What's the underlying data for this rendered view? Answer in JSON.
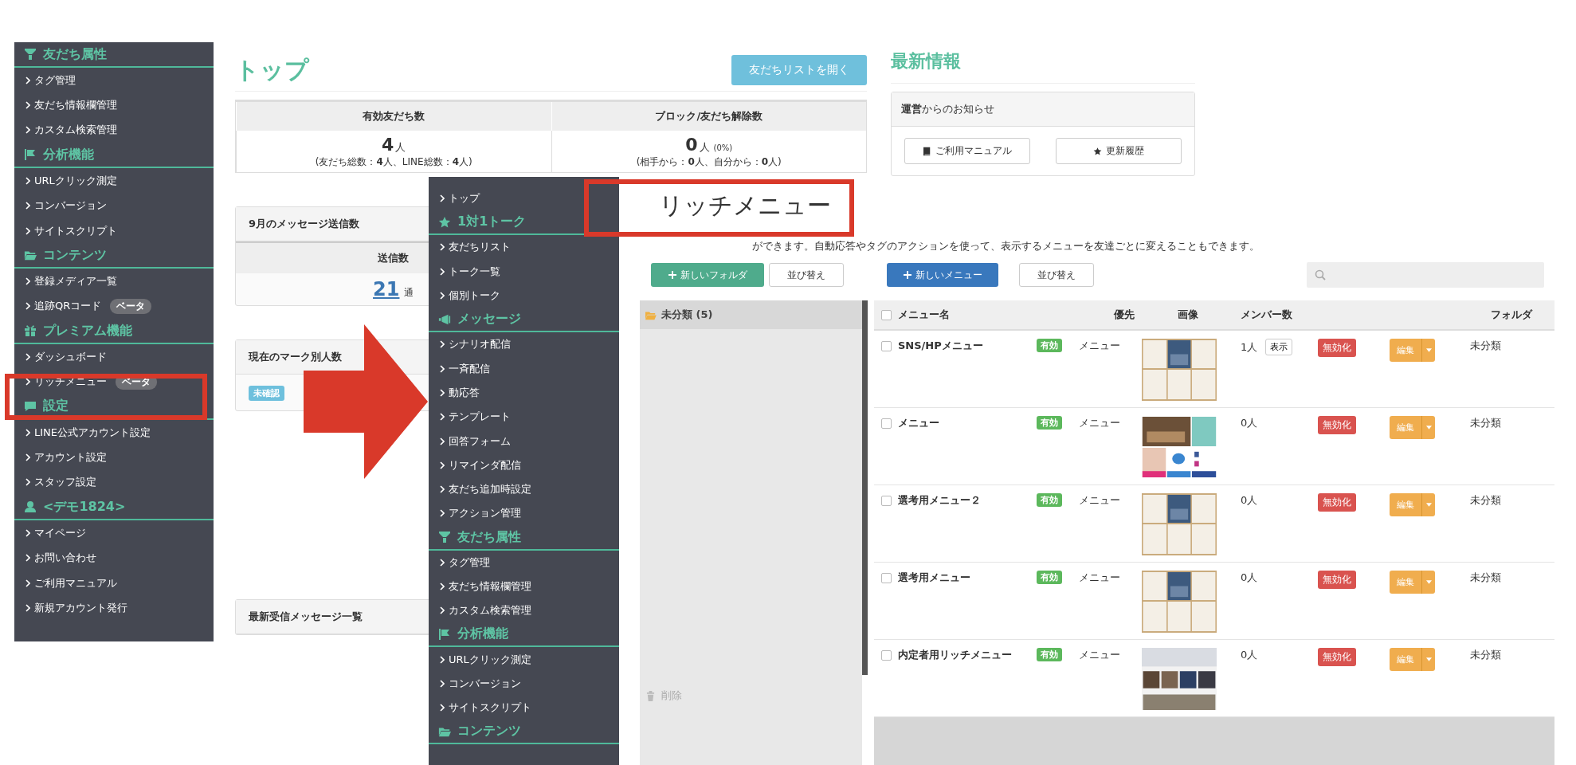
{
  "back_screen": {
    "sidebar": {
      "sections": [
        {
          "title": "友だち属性",
          "items": [
            {
              "label": "タグ管理"
            },
            {
              "label": "友だち情報欄管理"
            },
            {
              "label": "カスタム検索管理"
            }
          ]
        },
        {
          "title": "分析機能",
          "items": [
            {
              "label": "URLクリック測定"
            },
            {
              "label": "コンバージョン"
            },
            {
              "label": "サイトスクリプト"
            }
          ]
        },
        {
          "title": "コンテンツ",
          "items": [
            {
              "label": "登録メディア一覧"
            },
            {
              "label": "追跡QRコード",
              "badge": "ベータ"
            }
          ]
        },
        {
          "title": "プレミアム機能",
          "items": [
            {
              "label": "ダッシュボード"
            },
            {
              "label": "リッチメニュー",
              "badge": "ベータ"
            }
          ]
        },
        {
          "title": "設定",
          "items": [
            {
              "label": "LINE公式アカウント設定"
            },
            {
              "label": "アカウント設定"
            },
            {
              "label": "スタッフ設定"
            }
          ]
        },
        {
          "title": "<デモ1824>",
          "items": [
            {
              "label": "マイページ"
            },
            {
              "label": "お問い合わせ"
            },
            {
              "label": "ご利用マニュアル"
            },
            {
              "label": "新規アカウント発行"
            }
          ]
        }
      ]
    },
    "page": {
      "title": "トップ",
      "open_list_button": "友だちリストを開く",
      "friend_stats": [
        {
          "heading": "有効友だち数",
          "value": "4",
          "unit": "人",
          "detail": "(友だち総数：**4**人、LINE総数：**4**人)"
        },
        {
          "heading": "ブロック/友だち解除数",
          "value": "0",
          "unit": "人",
          "percent": "(0%)",
          "detail": "(相手から：**0**人、自分から：**0**人)"
        }
      ],
      "message_card": {
        "title": "9月のメッセージ送信数",
        "column": "送信数",
        "value": "21",
        "unit": "通"
      },
      "mark_card": {
        "title": "現在のマーク別人数",
        "tags": [
          "未確認"
        ]
      },
      "inbox_card": {
        "title": "最新受信メッセージ一覧"
      }
    },
    "news": {
      "title": "最新情報",
      "notice_header": "**運営**からのお知らせ",
      "buttons": [
        {
          "label": "ご利用マニュアル"
        },
        {
          "label": "更新履歴"
        }
      ]
    }
  },
  "front_screen": {
    "sidebar": {
      "top_items": [
        {
          "label": "トップ"
        }
      ],
      "sections": [
        {
          "title": "1対1トーク",
          "items": [
            {
              "label": "友だちリスト"
            },
            {
              "label": "トーク一覧"
            },
            {
              "label": "個別トーク"
            }
          ]
        },
        {
          "title": "メッセージ",
          "items": [
            {
              "label": "シナリオ配信"
            },
            {
              "label": "一斉配信"
            },
            {
              "label": "動応答"
            },
            {
              "label": "テンプレート"
            },
            {
              "label": "回答フォーム"
            },
            {
              "label": "リマインダ配信"
            },
            {
              "label": "友だち追加時設定"
            },
            {
              "label": "アクション管理"
            }
          ]
        },
        {
          "title": "友だち属性",
          "items": [
            {
              "label": "タグ管理"
            },
            {
              "label": "友だち情報欄管理"
            },
            {
              "label": "カスタム検索管理"
            }
          ]
        },
        {
          "title": "分析機能",
          "items": [
            {
              "label": "URLクリック測定"
            },
            {
              "label": "コンバージョン"
            },
            {
              "label": "サイトスクリプト"
            }
          ]
        },
        {
          "title": "コンテンツ"
        }
      ]
    },
    "title": "リッチメニュー",
    "description": "ができます。自動応答やタグのアクションを使って、表示するメニューを友達ごとに変えることもできます。",
    "folder_buttons": {
      "new": "新しいフォルダ",
      "sort": "並び替え"
    },
    "menu_buttons": {
      "new": "新しいメニュー",
      "sort": "並び替え"
    },
    "folders": [
      {
        "label": "未分類 (5)",
        "selected": true
      }
    ],
    "delete_label": "削除",
    "table": {
      "header_checked": false,
      "columns": [
        "メニュー名",
        "優先",
        "画像",
        "メンバー数",
        "フォルダ"
      ],
      "rows": [
        {
          "checked": false,
          "name": "SNS/HPメニュー",
          "status": "有効",
          "priority": "メニュー",
          "members": "1人",
          "members_button": "表示",
          "disable_button": "無効化",
          "edit_button": "編集",
          "folder": "未分類"
        },
        {
          "checked": false,
          "name": "メニュー",
          "status": "有効",
          "priority": "メニュー",
          "members": "0人",
          "disable_button": "無効化",
          "edit_button": "編集",
          "folder": "未分類"
        },
        {
          "checked": false,
          "name": "選考用メニュー２",
          "status": "有効",
          "priority": "メニュー",
          "members": "0人",
          "disable_button": "無効化",
          "edit_button": "編集",
          "folder": "未分類"
        },
        {
          "checked": false,
          "name": "選考用メニュー",
          "status": "有効",
          "priority": "メニュー",
          "members": "0人",
          "disable_button": "無効化",
          "edit_button": "編集",
          "folder": "未分類"
        },
        {
          "checked": false,
          "name": "内定者用リッチメニュー",
          "status": "有効",
          "priority": "メニュー",
          "members": "0人",
          "disable_button": "無効化",
          "edit_button": "編集",
          "folder": "未分類"
        }
      ]
    }
  }
}
